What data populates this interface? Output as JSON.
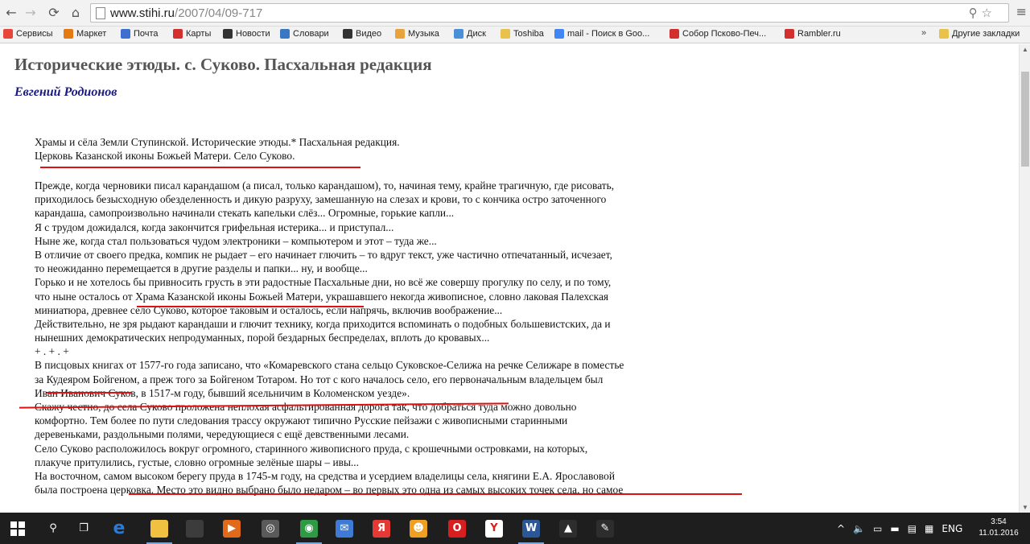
{
  "browser": {
    "url_host": "www.stihi.ru",
    "url_path": "/2007/04/09-717"
  },
  "bookmarks": [
    {
      "label": "Сервисы",
      "color": "#e8453c"
    },
    {
      "label": "Маркет",
      "color": "#e47911"
    },
    {
      "label": "Почта",
      "color": "#3d6fd0"
    },
    {
      "label": "Карты",
      "color": "#d32f2f"
    },
    {
      "label": "Новости",
      "color": "#333333"
    },
    {
      "label": "Словари",
      "color": "#3a78c3"
    },
    {
      "label": "Видео",
      "color": "#333333"
    },
    {
      "label": "Музыка",
      "color": "#e8a33c"
    },
    {
      "label": "Диск",
      "color": "#4a90d9"
    },
    {
      "label": "Toshiba",
      "color": "#e8c24a"
    },
    {
      "label": "mail - Поиск в Goo...",
      "color": "#4285f4"
    },
    {
      "label": "Собор Псково-Печ...",
      "color": "#d32f2f"
    },
    {
      "label": "Rambler.ru",
      "color": "#d32f2f"
    }
  ],
  "bookmarks_overflow": "»",
  "other_bookmarks": "Другие закладки",
  "page": {
    "title": "Исторические этюды. с. Суково. Пасхальная редакция",
    "author": "Евгений Родионов",
    "intro_lines": [
      "Храмы и сёла Земли Ступинской. Исторические этюды.* Пасхальная редакция.",
      "Церковь Казанской иконы Божьей Матери. Село Суково."
    ],
    "body_lines": [
      "Прежде, когда черновики писал карандашом (а писал, только карандашом), то, начиная тему, крайне трагичную, где рисовать,",
      "приходилось безысходную обезделенность и дикую разруху, замешанную на слезах и крови, то с кончика остро заточенного",
      "карандаша, самопроизвольно начинали стекать капельки слёз... Огромные, горькие капли...",
      "Я с трудом дожидался, когда закончится грифельная истерика... и приступал...",
      "Ныне же, когда стал пользоваться чудом электроники – компьютером и этот – туда же...",
      "В отличие от своего предка, компик не рыдает – его начинает глючить – то вдруг текст, уже частично отпечатанный, исчезает,",
      "то неожиданно перемещается в другие разделы и папки... ну, и вообще...",
      "Горько и не хотелось бы привносить грусть в эти радостные Пасхальные дни, но всё же совершу прогулку по селу, и по тому,",
      "что ныне осталось от Храма Казанской иконы Божьей Матери, украшавшего некогда живописное, словно лаковая Палехская",
      "миниатюра, древнее село Суково, которое таковым и осталось, если напрячь, включив воображение...",
      "Действительно, не зря рыдают карандаши и глючит технику, когда приходится вспоминать о подобных большевистских, да и",
      "нынешних демократических непродуманных, порой бездарных беспределах, вплоть до кровавых...",
      "+ . + . +",
      "В писцовых книгах от 1577-го года записано, что «Комаревского стана сельцо Суковское-Селижа на речке Селижаре в поместье",
      "за Кудеяром Бойгеном, а преж того за Бойгеном Тотаром. Но тот с кого началось село, его первоначальным владельцем был",
      "Иван Иванович Суков, в 1517-м году, бывший ясельничим в Коломенском уезде».",
      "Скажу честно, до села Суково проложена неплохая асфальтированная дорога так, что добраться туда можно довольно",
      "комфортно. Тем более по пути следования трассу окружают типично Русские пейзажи с живописными старинными",
      "деревеньками, раздольными полями, чередующиеся с ещё девственными лесами.",
      "Село Суково расположилось вокруг огромного, старинного живописного пруда, с крошечными островками, на которых,",
      "плакуче притулились, густые, словно огромные зелёные шары – ивы...",
      "На восточном, самом высоком берегу пруда в 1745-м году, на средства и усердием владелицы села, княгини Е.А. Ярославовой",
      "была построена церковка. Место это видно выбрано было недаром – во первых это одна из самых высоких точек села, но самое"
    ]
  },
  "taskbar": {
    "apps": [
      {
        "name": "search",
        "glyph": "⚲",
        "color": "#1e1e1e"
      },
      {
        "name": "task-view",
        "glyph": "❐",
        "color": "#1e1e1e"
      },
      {
        "name": "edge",
        "glyph": "e",
        "color": "#1e1e1e"
      },
      {
        "name": "file-explorer",
        "glyph": "",
        "color": "#f0c040"
      },
      {
        "name": "store",
        "glyph": "",
        "color": "#3c3c3c"
      },
      {
        "name": "media-player",
        "glyph": "▶",
        "color": "#e06a1a"
      },
      {
        "name": "app-circle",
        "glyph": "◎",
        "color": "#5a5a5a"
      },
      {
        "name": "chrome",
        "glyph": "◉",
        "color": "#2e9b44"
      },
      {
        "name": "mail",
        "glyph": "✉",
        "color": "#3d7bd6"
      },
      {
        "name": "yandex",
        "glyph": "Я",
        "color": "#e53935"
      },
      {
        "name": "game",
        "glyph": "☻",
        "color": "#f0a020"
      },
      {
        "name": "opera",
        "glyph": "O",
        "color": "#d81e1e"
      },
      {
        "name": "yandex-browser",
        "glyph": "Y",
        "color": "#ffffff"
      },
      {
        "name": "word",
        "glyph": "W",
        "color": "#2b5797"
      },
      {
        "name": "photos",
        "glyph": "▲",
        "color": "#2d2d2d"
      },
      {
        "name": "paint",
        "glyph": "✎",
        "color": "#2d2d2d"
      }
    ],
    "tray_lang": "ENG",
    "time": "3:54",
    "date": "11.01.2016"
  }
}
